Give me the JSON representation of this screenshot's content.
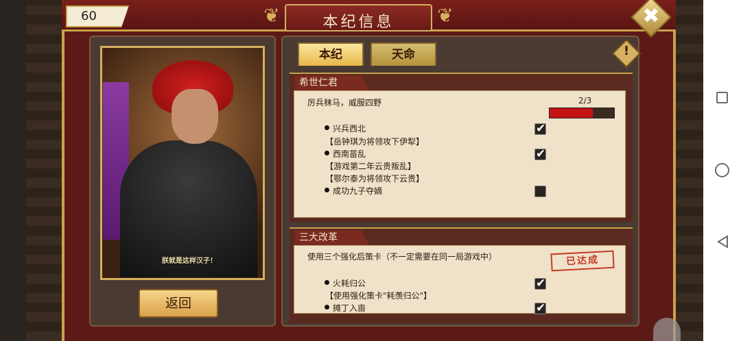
{
  "counter": "60",
  "title": "本纪信息",
  "close_glyph": "✖",
  "portrait": {
    "caption": "朕就是这样汉子！"
  },
  "back_label": "返回",
  "tabs": [
    {
      "label": "本纪"
    },
    {
      "label": "天命"
    }
  ],
  "warning_glyph": "!",
  "sections": [
    {
      "header": "希世仁君",
      "description": "厉兵秣马，威服四野",
      "progress_text": "2/3",
      "progress": 0.6667,
      "items": [
        {
          "label": "兴兵西北",
          "notes": [
            "【岳钟琪为将领攻下伊犁】"
          ],
          "checked": true
        },
        {
          "label": "西南苗乱",
          "notes": [
            "【游戏第二年云贵叛乱】",
            "【鄂尔泰为将领攻下云贵】"
          ],
          "checked": true
        },
        {
          "label": "成功九子夺嫡",
          "notes": [],
          "checked": false
        }
      ]
    },
    {
      "header": "三大改革",
      "description": "使用三个强化后策卡（不一定需要在同一局游戏中）",
      "stamp": "已达成",
      "items": [
        {
          "label": "火耗归公",
          "notes": [
            "【使用强化策卡\"耗羡归公\"】"
          ],
          "checked": true
        },
        {
          "label": "摊丁入亩",
          "notes": [],
          "checked": true
        }
      ]
    }
  ],
  "icons": {
    "close": "close-x-icon",
    "warning": "warning-diamond-icon",
    "check": "checkmark-icon",
    "lock": "lock-icon"
  }
}
